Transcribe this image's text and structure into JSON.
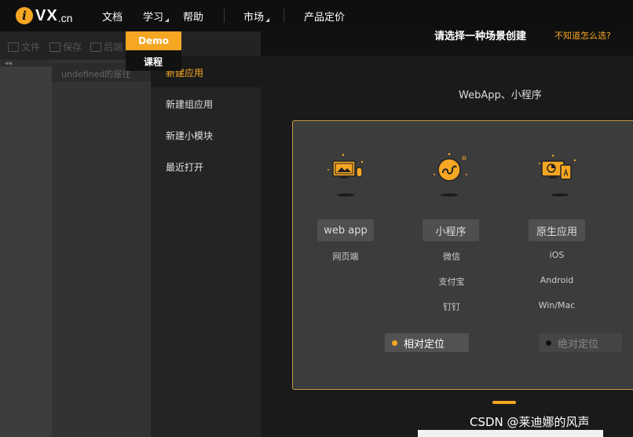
{
  "nav": {
    "logo_badge": "i",
    "logo_text": "VX",
    "logo_suffix": ".cn",
    "docs": "文档",
    "learn": "学习",
    "help": "帮助",
    "market": "市场",
    "pricing": "产品定价"
  },
  "dropdown": {
    "demo": "Demo",
    "course": "课程"
  },
  "toolbar": {
    "file": "文件",
    "save": "保存",
    "backend": "后端"
  },
  "editor": {
    "collapse": "◂◂",
    "tab_label": "undefined的屋往"
  },
  "modal": {
    "prompt": "请选择一种场景创建",
    "prompt_link": "不知道怎么选?",
    "sidebar": [
      "新建应用",
      "新建组应用",
      "新建小模块",
      "最近打开"
    ],
    "section_title": "WebApp、小程序",
    "options": [
      {
        "label": "web app",
        "icon": "webapp-icon",
        "platforms": [
          "网页端"
        ]
      },
      {
        "label": "小程序",
        "icon": "miniprogram-icon",
        "platforms": [
          "微信",
          "支付宝",
          "钉钉"
        ]
      },
      {
        "label": "原生应用",
        "icon": "native-app-icon",
        "platforms": [
          "iOS",
          "Android",
          "Win/Mac"
        ]
      }
    ],
    "positioning": [
      {
        "label": "相对定位",
        "selected": true
      },
      {
        "label": "绝对定位",
        "selected": false
      }
    ]
  },
  "watermark": "CSDN @莱迪娜的风声",
  "colors": {
    "accent": "#f5a623",
    "card_border": "#c79a42",
    "background": "#1a1a1a"
  }
}
